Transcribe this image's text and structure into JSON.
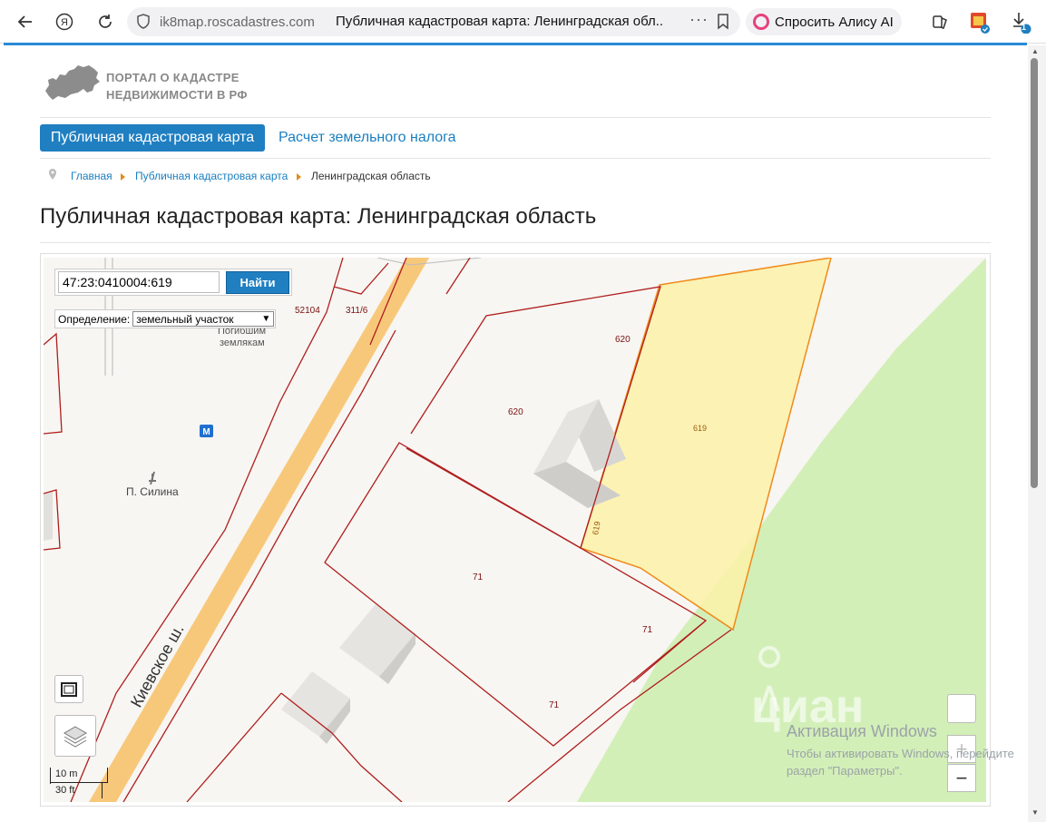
{
  "browser": {
    "host": "ik8map.roscadastres.com",
    "tab_title": "Публичная кадастровая карта: Ленинградская обл...",
    "alice_label": "Спросить Алису AI",
    "downloads_badge": "1"
  },
  "site": {
    "logo_line1": "ПОРТАЛ О КАДАСТРЕ",
    "logo_line2": "НЕДВИЖИМОСТИ В РФ"
  },
  "nav": {
    "active_tab": "Публичная кадастровая карта",
    "tab_tax": "Расчет земельного налога"
  },
  "breadcrumb": {
    "home": "Главная",
    "map": "Публичная кадастровая карта",
    "current": "Ленинградская область"
  },
  "page_title": "Публичная кадастровая карта: Ленинградская область",
  "map": {
    "search_value": "47:23:0410004:619",
    "search_button": "Найти",
    "definition_label": "Определение:",
    "definition_value": "земельный участок",
    "labels": {
      "n52104": "52104",
      "n311_6": "311/6",
      "pogibshim": "Погибшим",
      "zemlyakam": "землякам",
      "p_silina": "П. Силина",
      "road": "Киевское ш.",
      "p620a": "620",
      "p620b": "620",
      "p619": "619",
      "p619b": "619",
      "p71a": "71",
      "p71b": "71",
      "p71c": "71",
      "watermark": "циан",
      "metro_icon": "М"
    },
    "scale_m": "10 m",
    "scale_ft": "30 ft",
    "zoom_in": "+",
    "zoom_out": "−"
  },
  "windows_activation": {
    "title": "Активация Windows",
    "line1": "Чтобы активировать Windows, перейдите",
    "line2": "раздел \"Параметры\"."
  },
  "colors": {
    "accent": "#1f7fc1",
    "parcel_border": "#b01e1e",
    "selected_fill": "#fbf1a8",
    "forest": "#d3efb8",
    "road": "#f8c87a"
  }
}
